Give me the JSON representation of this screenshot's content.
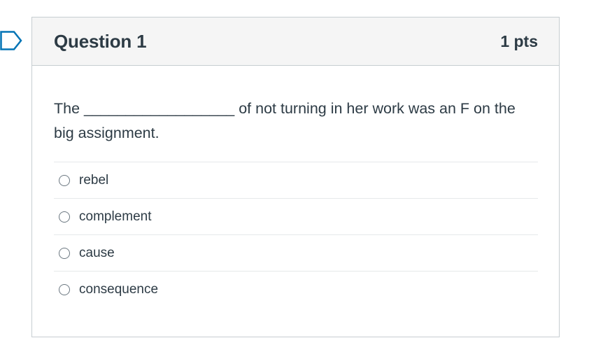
{
  "question": {
    "title": "Question 1",
    "points": "1 pts",
    "text": "The __________________ of not turning in her work was an F on the big assignment."
  },
  "answers": [
    {
      "label": "rebel"
    },
    {
      "label": "complement"
    },
    {
      "label": "cause"
    },
    {
      "label": "consequence"
    }
  ],
  "colors": {
    "text": "#2d3b45",
    "header_bg": "#f5f5f5",
    "border": "#c7cdd1",
    "flag": "#0374b5"
  },
  "icons": {
    "flag": "bookmark-flag-icon",
    "radio": "radio-button-icon"
  }
}
